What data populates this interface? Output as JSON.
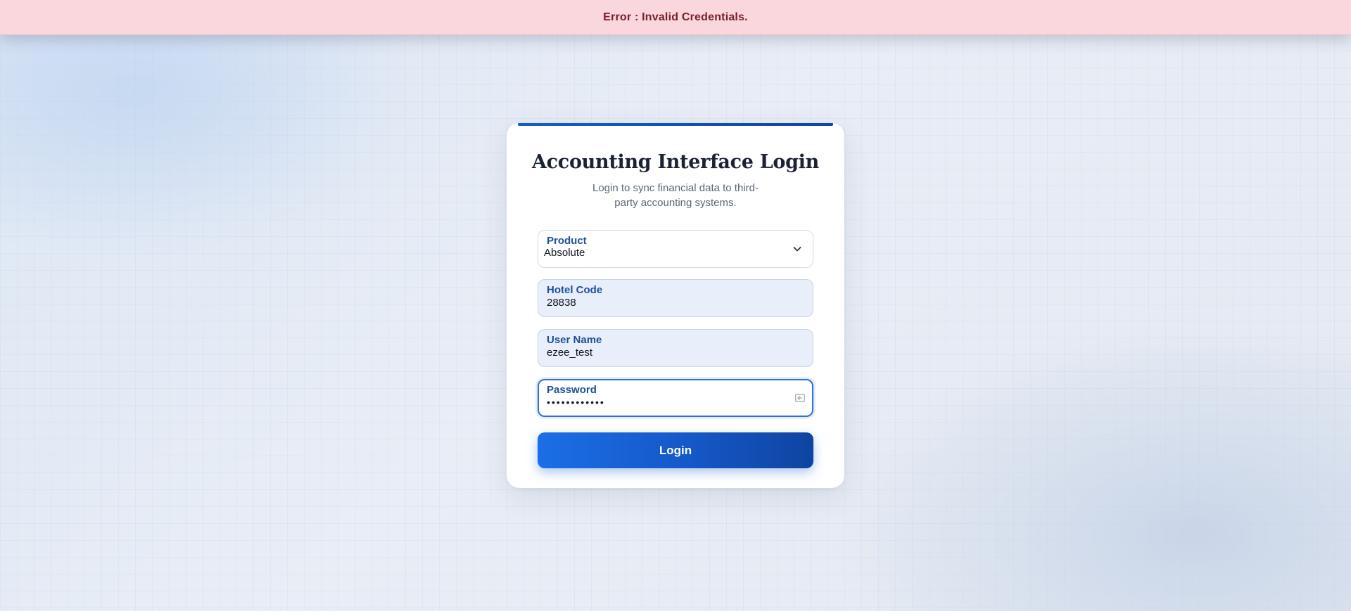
{
  "banner": {
    "message": "Error : Invalid Credentials."
  },
  "card": {
    "title": "Accounting Interface Login",
    "subtitle": "Login to sync financial data to third-party accounting systems."
  },
  "form": {
    "product": {
      "label": "Product",
      "value": "Absolute"
    },
    "hotel_code": {
      "label": "Hotel Code",
      "value": "28838"
    },
    "user_name": {
      "label": "User Name",
      "value": "ezee_test"
    },
    "password": {
      "label": "Password",
      "value": "••••••••••••"
    },
    "login_label": "Login"
  },
  "icons": {
    "product_dropdown": "chevron-down-icon",
    "password_toggle": "password-reveal-icon"
  },
  "colors": {
    "error_background": "#f9d7dc",
    "error_text": "#7a1f2b",
    "accent": "#1558c8",
    "label": "#1f4f9a"
  }
}
